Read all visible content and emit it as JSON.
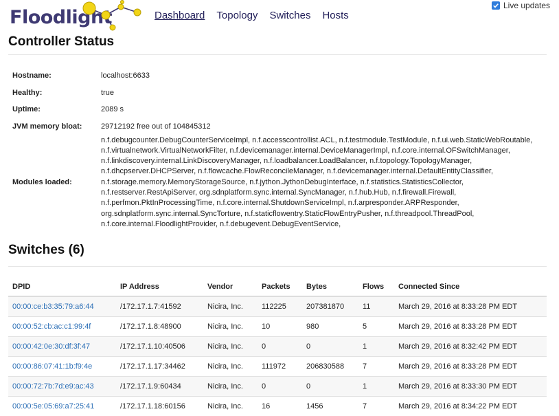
{
  "brand": {
    "name": "Floodlight"
  },
  "nav": [
    {
      "label": "Dashboard",
      "active": true
    },
    {
      "label": "Topology",
      "active": false
    },
    {
      "label": "Switches",
      "active": false
    },
    {
      "label": "Hosts",
      "active": false
    }
  ],
  "live_updates": {
    "label": "Live updates",
    "checked": true
  },
  "controller": {
    "title": "Controller Status",
    "hostname_label": "Hostname:",
    "hostname": "localhost:6633",
    "healthy_label": "Healthy:",
    "healthy": "true",
    "uptime_label": "Uptime:",
    "uptime": "2089 s",
    "jvm_label": "JVM memory bloat:",
    "jvm": "29712192 free out of 104845312",
    "modules_label": "Modules loaded:",
    "modules_lines": [
      "n.f.debugcounter.DebugCounterServiceImpl, n.f.accesscontrollist.ACL, n.f.testmodule.TestModule, n.f.ui.web.StaticWebRoutable,",
      "n.f.virtualnetwork.VirtualNetworkFilter, n.f.devicemanager.internal.DeviceManagerImpl, n.f.core.internal.OFSwitchManager,",
      "n.f.linkdiscovery.internal.LinkDiscoveryManager, n.f.loadbalancer.LoadBalancer, n.f.topology.TopologyManager,",
      "n.f.dhcpserver.DHCPServer, n.f.flowcache.FlowReconcileManager, n.f.devicemanager.internal.DefaultEntityClassifier,",
      "n.f.storage.memory.MemoryStorageSource, n.f.jython.JythonDebugInterface, n.f.statistics.StatisticsCollector,",
      "n.f.restserver.RestApiServer, org.sdnplatform.sync.internal.SyncManager, n.f.hub.Hub, n.f.firewall.Firewall,",
      "n.f.perfmon.PktInProcessingTime, n.f.core.internal.ShutdownServiceImpl, n.f.arpresponder.ARPResponder,",
      "org.sdnplatform.sync.internal.SyncTorture, n.f.staticflowentry.StaticFlowEntryPusher, n.f.threadpool.ThreadPool,",
      "n.f.core.internal.FloodlightProvider, n.f.debugevent.DebugEventService,"
    ]
  },
  "switches": {
    "title": "Switches (6)",
    "columns": [
      "DPID",
      "IP Address",
      "Vendor",
      "Packets",
      "Bytes",
      "Flows",
      "Connected Since"
    ],
    "rows": [
      [
        "00:00:ce:b3:35:79:a6:44",
        "/172.17.1.7:41592",
        "Nicira, Inc.",
        "112225",
        "207381870",
        "11",
        "March 29, 2016 at 8:33:28 PM EDT"
      ],
      [
        "00:00:52:cb:ac:c1:99:4f",
        "/172.17.1.8:48900",
        "Nicira, Inc.",
        "10",
        "980",
        "5",
        "March 29, 2016 at 8:33:28 PM EDT"
      ],
      [
        "00:00:42:0e:30:df:3f:47",
        "/172.17.1.10:40506",
        "Nicira, Inc.",
        "0",
        "0",
        "1",
        "March 29, 2016 at 8:32:42 PM EDT"
      ],
      [
        "00:00:86:07:41:1b:f9:4e",
        "/172.17.1.17:34462",
        "Nicira, Inc.",
        "111972",
        "206830588",
        "7",
        "March 29, 2016 at 8:33:28 PM EDT"
      ],
      [
        "00:00:72:7b:7d:e9:ac:43",
        "/172.17.1.9:60434",
        "Nicira, Inc.",
        "0",
        "0",
        "1",
        "March 29, 2016 at 8:33:30 PM EDT"
      ],
      [
        "00:00:5e:05:69:a7:25:41",
        "/172.17.1.18:60156",
        "Nicira, Inc.",
        "16",
        "1456",
        "7",
        "March 29, 2016 at 8:34:22 PM EDT"
      ]
    ]
  },
  "colors": {
    "brand": "#3f3a73",
    "link": "#2a6eb6",
    "logo_node": "#f2d516",
    "checkbox": "#2f7ddc"
  }
}
